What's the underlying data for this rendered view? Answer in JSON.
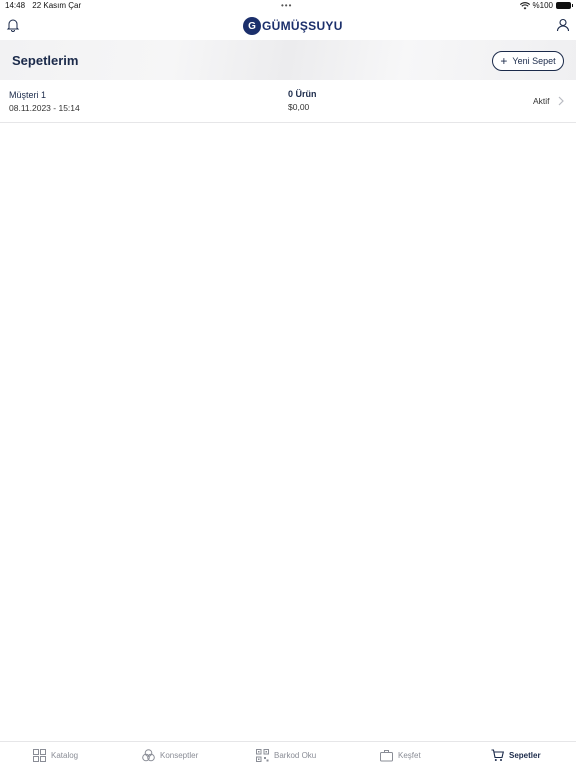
{
  "status_bar": {
    "time": "14:48",
    "date": "22 Kasım Çar",
    "battery": "%100"
  },
  "header": {
    "logo_text": "GÜMÜŞSUYU",
    "logo_mark": "G"
  },
  "page": {
    "title": "Sepetlerim",
    "new_cart_label": "Yeni Sepet"
  },
  "carts": [
    {
      "name": "Müşteri 1",
      "date": "08.11.2023 - 15:14",
      "item_count": "0 Ürün",
      "total": "$0,00",
      "status": "Aktif"
    }
  ],
  "tabs": [
    {
      "label": "Katalog",
      "icon": "grid-icon",
      "active": false
    },
    {
      "label": "Konseptler",
      "icon": "circles-icon",
      "active": false
    },
    {
      "label": "Barkod Oku",
      "icon": "qr-code-icon",
      "active": false
    },
    {
      "label": "Keşfet",
      "icon": "briefcase-icon",
      "active": false
    },
    {
      "label": "Sepetler",
      "icon": "cart-icon",
      "active": true
    }
  ],
  "colors": {
    "brand": "#1b2f6b",
    "text": "#1b2a4a",
    "inactive_tab": "#8a8d96"
  }
}
